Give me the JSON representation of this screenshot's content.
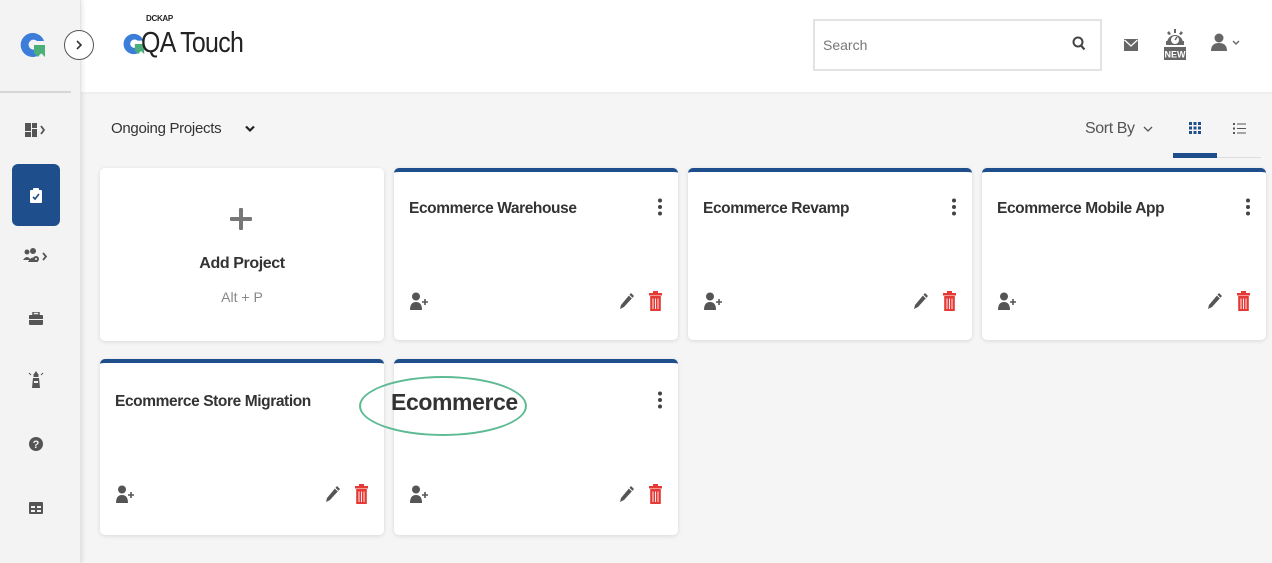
{
  "app": {
    "brand_small": "DCKAP",
    "brand_name": "QA Touch"
  },
  "sidebar": {
    "items": [
      {
        "name": "dashboard",
        "icon": "dashboard-icon",
        "has_submenu": true,
        "active": false
      },
      {
        "name": "projects",
        "icon": "clipboard-check-icon",
        "has_submenu": false,
        "active": true
      },
      {
        "name": "users",
        "icon": "users-gear-icon",
        "has_submenu": true,
        "active": false
      },
      {
        "name": "jobs",
        "icon": "briefcase-icon",
        "has_submenu": false,
        "active": false
      },
      {
        "name": "lighthouse",
        "icon": "lighthouse-icon",
        "has_submenu": false,
        "active": false
      },
      {
        "name": "help",
        "icon": "help-icon",
        "has_submenu": false,
        "active": false
      },
      {
        "name": "reports",
        "icon": "table-icon",
        "has_submenu": false,
        "active": false
      }
    ],
    "accent": "#1f4e8c"
  },
  "header": {
    "search": {
      "placeholder": "Search",
      "value": ""
    },
    "icons": [
      "mail-icon",
      "whats-new-icon",
      "user-menu-icon"
    ],
    "new_badge": "NEW"
  },
  "toolbar": {
    "filter_label": "Ongoing Projects",
    "sort_label": "Sort By",
    "view_modes": [
      "grid",
      "list"
    ],
    "active_view": "grid"
  },
  "add_project": {
    "label": "Add Project",
    "shortcut": "Alt + P"
  },
  "projects": [
    {
      "title": "Ecommerce Warehouse"
    },
    {
      "title": "Ecommerce Revamp"
    },
    {
      "title": "Ecommerce Mobile App"
    },
    {
      "title": "Ecommerce Store Migration"
    },
    {
      "title": "Ecommerce"
    }
  ],
  "colors": {
    "primary": "#1f4e8c",
    "delete": "#e53935",
    "icon_gray": "#555555",
    "highlight": "#5dbb94"
  }
}
